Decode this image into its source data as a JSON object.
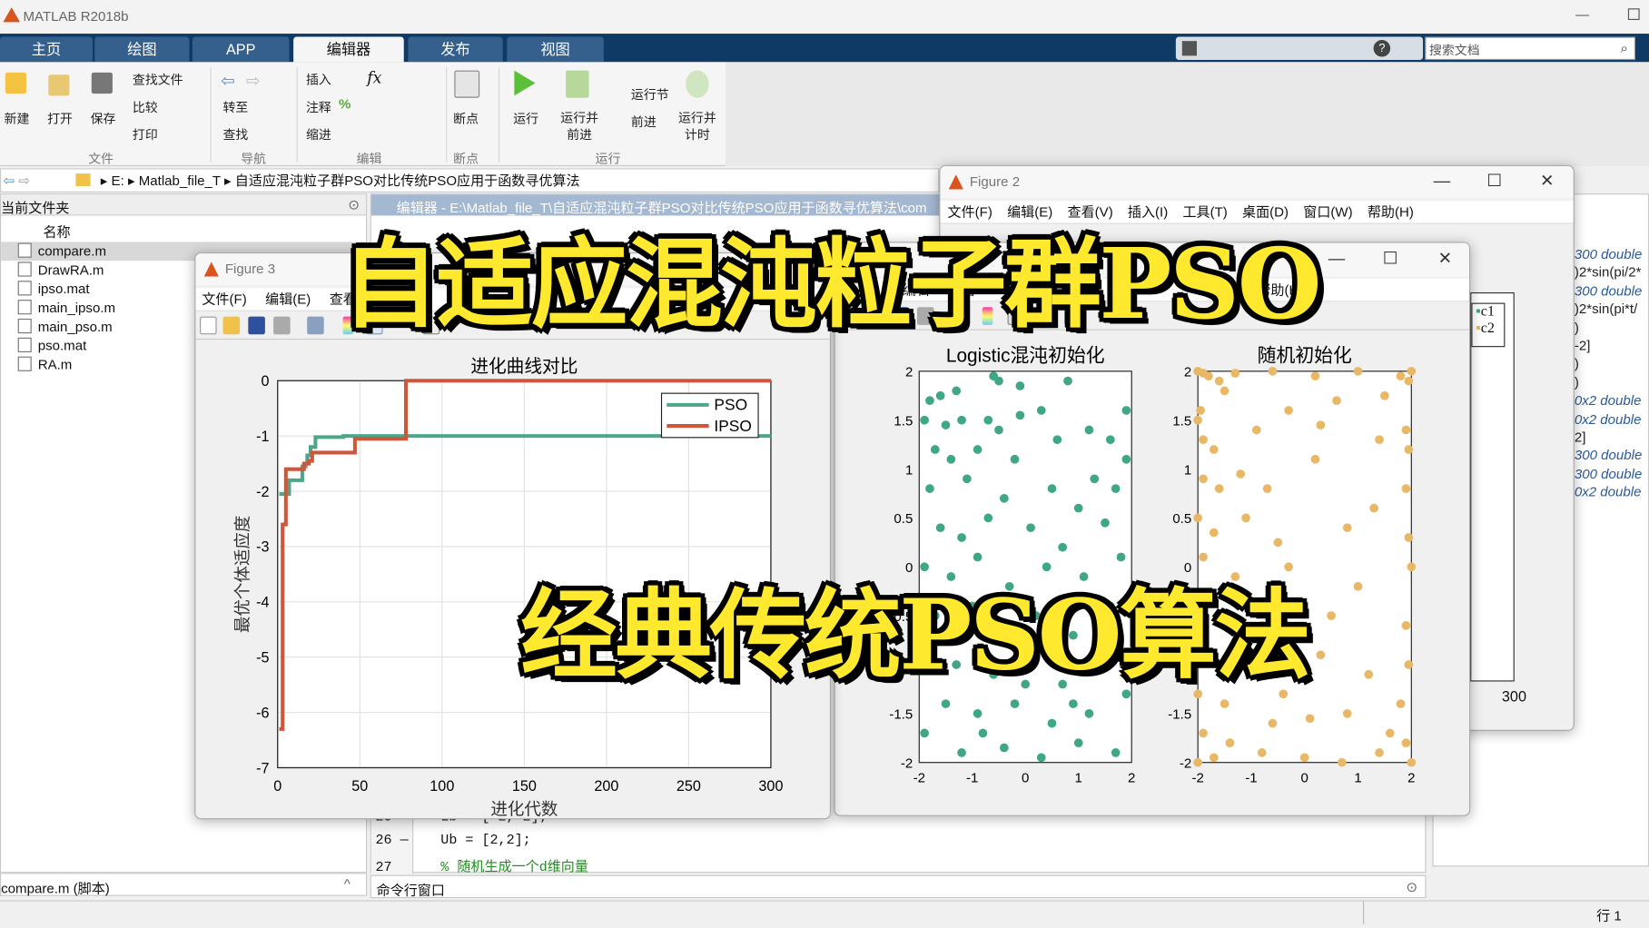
{
  "app": {
    "title": "MATLAB R2018b"
  },
  "tabs": [
    {
      "label": "主页"
    },
    {
      "label": "绘图"
    },
    {
      "label": "APP"
    },
    {
      "label": "编辑器",
      "active": true
    },
    {
      "label": "发布"
    },
    {
      "label": "视图"
    }
  ],
  "search": {
    "placeholder": "搜索文档"
  },
  "ribbon": {
    "file": {
      "new": "新建",
      "open": "打开",
      "save": "保存",
      "find_files": "查找文件",
      "compare": "比较",
      "print": "打印",
      "group": "文件"
    },
    "nav": {
      "goto": "转至",
      "find": "查找",
      "group": "导航"
    },
    "edit": {
      "insert": "插入",
      "comment": "注释",
      "indent": "缩进",
      "fx": "fx",
      "group": "编辑"
    },
    "breakpoints": {
      "label": "断点",
      "group": "断点"
    },
    "run": {
      "run": "运行",
      "run_advance": "运行并前进",
      "run_section": "运行节",
      "advance": "前进",
      "run_time": "运行并计时",
      "group": "运行"
    }
  },
  "address": {
    "drive": "E:",
    "folder1": "Matlab_file_T",
    "folder2": "自适应混沌粒子群PSO对比传统PSO应用于函数寻优算法"
  },
  "current_folder": {
    "title": "当前文件夹",
    "column": "名称",
    "files": [
      "compare.m",
      "DrawRA.m",
      "ipso.mat",
      "main_ipso.m",
      "main_pso.m",
      "pso.mat",
      "RA.m"
    ],
    "selected": "compare.m",
    "details": "compare.m  (脚本)"
  },
  "editor": {
    "title": "编辑器 - E:\\Matlab_file_T\\自适应混沌粒子群PSO对比传统PSO应用于函数寻优算法\\com",
    "lines": [
      {
        "num": "25",
        "text": "Lb = [-2,-2];"
      },
      {
        "num": "26 —",
        "text": "Ub = [2,2];"
      },
      {
        "num": "27",
        "text": "% 随机生成一个d维向量",
        "comment": true
      }
    ]
  },
  "command_window": {
    "title": "命令行窗口"
  },
  "workspace": {
    "lines": [
      {
        "t": "300 double",
        "it": true
      },
      {
        "t": ")2*sin(pi/2*"
      },
      {
        "t": "300 double",
        "it": true
      },
      {
        "t": ")2*sin(pi*t/"
      },
      {
        "t": ")"
      },
      {
        "t": "-2]"
      },
      {
        "t": ")"
      },
      {
        "t": ")"
      },
      {
        "t": "0x2 double",
        "it": true
      },
      {
        "t": "0x2 double",
        "it": true
      },
      {
        "t": "2]"
      },
      {
        "t": "300 double",
        "it": true
      },
      {
        "t": "300 double",
        "it": true
      },
      {
        "t": "0x2 double",
        "it": true
      }
    ]
  },
  "status": {
    "position": "行  1"
  },
  "figure2": {
    "title": "Figure 2",
    "menu": [
      "文件(F)",
      "编辑(E)",
      "查看(V)",
      "插入(I)",
      "工具(T)",
      "桌面(D)",
      "窗口(W)",
      "帮助(H)"
    ],
    "legend": [
      "c1",
      "c2"
    ],
    "xtick": "300"
  },
  "figure1": {
    "menu": [
      "编辑",
      "查看",
      "帮助(H)"
    ]
  },
  "figure3": {
    "title": "Figure 3",
    "menu": [
      "文件(F)",
      "编辑(E)",
      "查看"
    ]
  },
  "overlay": {
    "line1": "自适应混沌粒子群PSO",
    "line2": "经典传统PSO算法"
  },
  "colors": {
    "pso": "#4da58a",
    "ipso": "#d0563b",
    "c1": "#3fa784",
    "c2": "#e8b866",
    "tabbar": "#0f3a66"
  },
  "chart_data": [
    {
      "type": "line",
      "title": "进化曲线对比",
      "xlabel": "进化代数",
      "ylabel": "最优个体适应度",
      "xlim": [
        0,
        300
      ],
      "ylim": [
        -7,
        0
      ],
      "xticks": [
        0,
        50,
        100,
        150,
        200,
        250,
        300
      ],
      "yticks": [
        0,
        -1,
        -2,
        -3,
        -4,
        -5,
        -6,
        -7
      ],
      "grid": true,
      "legend_position": "top-right",
      "series": [
        {
          "name": "PSO",
          "points": [
            [
              1,
              -2.05
            ],
            [
              6,
              -2.05
            ],
            [
              7,
              -1.8
            ],
            [
              14,
              -1.8
            ],
            [
              15,
              -1.55
            ],
            [
              17,
              -1.5
            ],
            [
              18,
              -1.35
            ],
            [
              20,
              -1.2
            ],
            [
              23,
              -1.02
            ],
            [
              40,
              -1.0
            ],
            [
              300,
              -1.0
            ]
          ]
        },
        {
          "name": "IPSO",
          "points": [
            [
              1,
              -6.3
            ],
            [
              2,
              -6.3
            ],
            [
              3,
              -2.6
            ],
            [
              4,
              -2.6
            ],
            [
              5,
              -1.6
            ],
            [
              15,
              -1.6
            ],
            [
              16,
              -1.5
            ],
            [
              19,
              -1.45
            ],
            [
              21,
              -1.3
            ],
            [
              45,
              -1.3
            ],
            [
              47,
              -1.05
            ],
            [
              77,
              -1.05
            ],
            [
              78,
              0
            ],
            [
              300,
              0
            ]
          ]
        }
      ]
    },
    {
      "type": "scatter",
      "title": "Logistic混沌初始化",
      "xlim": [
        -2,
        2
      ],
      "ylim": [
        -2,
        2
      ],
      "xticks": [
        -2,
        -1,
        0,
        1,
        2
      ],
      "yticks": [
        2,
        1.5,
        1,
        0.5,
        0,
        -0.5,
        -1,
        -1.5,
        -2
      ],
      "series": [
        {
          "points": [
            [
              -1.8,
              1.7
            ],
            [
              -1.6,
              1.75
            ],
            [
              -1.3,
              1.8
            ],
            [
              -0.6,
              1.95
            ],
            [
              -0.5,
              1.9
            ],
            [
              -0.1,
              1.85
            ],
            [
              0.8,
              1.9
            ],
            [
              1.9,
              1.6
            ],
            [
              -1.9,
              1.5
            ],
            [
              -1.5,
              1.45
            ],
            [
              -1.2,
              1.5
            ],
            [
              -0.7,
              1.5
            ],
            [
              -0.5,
              1.4
            ],
            [
              0.3,
              1.6
            ],
            [
              1.6,
              1.3
            ],
            [
              1.9,
              1.1
            ],
            [
              -1.7,
              1.2
            ],
            [
              -1.4,
              1.1
            ],
            [
              -0.9,
              1.2
            ],
            [
              -0.2,
              1.1
            ],
            [
              0.6,
              1.3
            ],
            [
              1.2,
              1.4
            ],
            [
              -1.8,
              0.8
            ],
            [
              -1.1,
              0.9
            ],
            [
              -0.4,
              0.7
            ],
            [
              0.5,
              0.8
            ],
            [
              1.0,
              0.6
            ],
            [
              1.7,
              0.8
            ],
            [
              -1.6,
              0.4
            ],
            [
              -1.2,
              0.3
            ],
            [
              -0.7,
              0.5
            ],
            [
              0.1,
              0.4
            ],
            [
              0.7,
              0.2
            ],
            [
              1.5,
              0.45
            ],
            [
              -1.9,
              0.0
            ],
            [
              -1.4,
              -0.1
            ],
            [
              -0.9,
              0.1
            ],
            [
              -0.3,
              -0.2
            ],
            [
              0.4,
              0.0
            ],
            [
              1.1,
              -0.1
            ],
            [
              1.8,
              0.1
            ],
            [
              -1.7,
              -0.5
            ],
            [
              -1.0,
              -0.4
            ],
            [
              -0.5,
              -0.6
            ],
            [
              0.2,
              -0.5
            ],
            [
              0.9,
              -0.7
            ],
            [
              1.6,
              -0.4
            ],
            [
              -1.8,
              -0.9
            ],
            [
              -1.3,
              -1.0
            ],
            [
              -0.6,
              -1.1
            ],
            [
              0.1,
              -0.9
            ],
            [
              0.7,
              -1.2
            ],
            [
              1.4,
              -1.0
            ],
            [
              1.9,
              -1.3
            ],
            [
              -1.5,
              -1.4
            ],
            [
              -0.9,
              -1.5
            ],
            [
              -0.2,
              -1.4
            ],
            [
              0.5,
              -1.6
            ],
            [
              1.2,
              -1.5
            ],
            [
              -1.9,
              -1.7
            ],
            [
              -1.2,
              -1.9
            ],
            [
              -0.4,
              -1.85
            ],
            [
              0.3,
              -1.95
            ],
            [
              1.0,
              -1.8
            ],
            [
              1.7,
              -1.9
            ],
            [
              -0.8,
              -1.7
            ],
            [
              0.9,
              -1.4
            ],
            [
              1.3,
              0.9
            ],
            [
              -0.1,
              1.55
            ],
            [
              0.0,
              -1.2
            ]
          ]
        }
      ]
    },
    {
      "type": "scatter",
      "title": "随机初始化",
      "xlim": [
        -2,
        2
      ],
      "ylim": [
        -2,
        2
      ],
      "xticks": [
        -2,
        -1,
        0,
        1,
        2
      ],
      "yticks": [
        2,
        1.5,
        1,
        0.5,
        0,
        -0.5,
        -1,
        -1.5,
        -2
      ],
      "series": [
        {
          "points": [
            [
              -2,
              2
            ],
            [
              -1.9,
              1.98
            ],
            [
              -1.8,
              1.95
            ],
            [
              -1.6,
              1.9
            ],
            [
              -1.3,
              1.98
            ],
            [
              -0.6,
              2
            ],
            [
              0.2,
              1.95
            ],
            [
              1.0,
              2
            ],
            [
              1.8,
              1.95
            ],
            [
              2,
              2
            ],
            [
              1.95,
              1.9
            ],
            [
              -1.95,
              1.6
            ],
            [
              -1.5,
              1.8
            ],
            [
              -0.3,
              1.6
            ],
            [
              0.6,
              1.7
            ],
            [
              1.5,
              1.75
            ],
            [
              1.9,
              1.4
            ],
            [
              -2,
              1.5
            ],
            [
              -1.9,
              1.3
            ],
            [
              -1.7,
              1.2
            ],
            [
              -0.9,
              1.4
            ],
            [
              0.3,
              1.45
            ],
            [
              1.4,
              1.3
            ],
            [
              1.95,
              1.2
            ],
            [
              -1.9,
              0.9
            ],
            [
              -1.6,
              0.8
            ],
            [
              -1.2,
              0.95
            ],
            [
              -0.7,
              0.8
            ],
            [
              0.2,
              1.1
            ],
            [
              1.3,
              0.6
            ],
            [
              1.9,
              0.8
            ],
            [
              -2,
              0.5
            ],
            [
              -1.7,
              0.35
            ],
            [
              -1.1,
              0.5
            ],
            [
              -0.5,
              0.25
            ],
            [
              0.8,
              0.4
            ],
            [
              1.95,
              0.3
            ],
            [
              -1.9,
              0.1
            ],
            [
              -1.3,
              -0.1
            ],
            [
              -0.3,
              0.0
            ],
            [
              1.0,
              -0.2
            ],
            [
              2,
              0.0
            ],
            [
              -2,
              -0.3
            ],
            [
              -1.6,
              -0.5
            ],
            [
              -0.8,
              -0.6
            ],
            [
              0.5,
              -0.5
            ],
            [
              1.9,
              -0.6
            ],
            [
              -1.95,
              -0.9
            ],
            [
              -1.2,
              -1.0
            ],
            [
              0.3,
              -0.9
            ],
            [
              1.2,
              -1.1
            ],
            [
              1.95,
              -1.0
            ],
            [
              -2,
              -1.3
            ],
            [
              -1.5,
              -1.4
            ],
            [
              -0.4,
              -1.3
            ],
            [
              0.8,
              -1.5
            ],
            [
              1.8,
              -1.4
            ],
            [
              -1.9,
              -1.7
            ],
            [
              -1.4,
              -1.8
            ],
            [
              -0.8,
              -1.9
            ],
            [
              0,
              -1.95
            ],
            [
              0.7,
              -2
            ],
            [
              1.4,
              -1.9
            ],
            [
              2,
              -2
            ],
            [
              -2,
              -2
            ],
            [
              -1.7,
              -1.95
            ],
            [
              1.9,
              -1.8
            ],
            [
              0.1,
              -1.55
            ],
            [
              -0.6,
              -1.6
            ],
            [
              1.6,
              -1.7
            ]
          ]
        }
      ]
    }
  ]
}
